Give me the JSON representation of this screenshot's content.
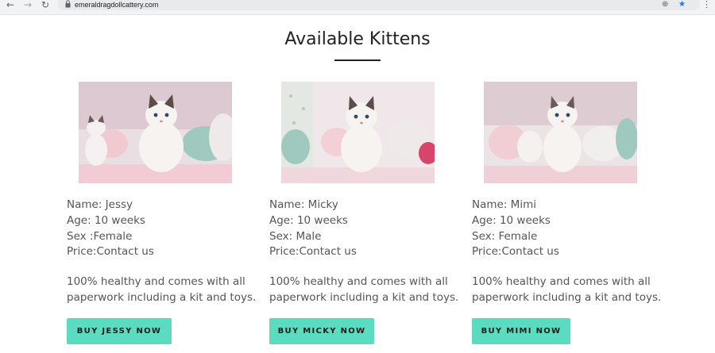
{
  "browser": {
    "url": "emeraldragdollcattery.com",
    "icons": [
      "back-arrow-icon",
      "forward-arrow-icon",
      "reload-icon",
      "lock-icon",
      "zoom-icon",
      "star-icon",
      "menu-icon"
    ]
  },
  "page": {
    "title": "Available Kittens"
  },
  "kittens": [
    {
      "name": "Name: Jessy",
      "age": "Age: 10 weeks",
      "sex": "Sex :Female",
      "price": "Price:Contact us",
      "desc_line1": "100% healthy and comes with all",
      "desc_line2": "paperwork including a kit and toys.",
      "button": "BUY JESSY NOW"
    },
    {
      "name": "Name: Micky",
      "age": "Age: 10 weeks",
      "sex": "Sex: Male",
      "price": "Price:Contact us",
      "desc_line1": "100% healthy and comes with all",
      "desc_line2": "paperwork including a kit and toys.",
      "button": "BUY MICKY NOW"
    },
    {
      "name": "Name: Mimi",
      "age": "Age: 10 weeks",
      "sex": "Sex: Female",
      "price": "Price:Contact us",
      "desc_line1": "100% healthy and comes with all",
      "desc_line2": "paperwork including a kit and toys.",
      "button": "BUY MIMI NOW"
    }
  ],
  "colors": {
    "button": "#5bdcc0",
    "text": "#555555",
    "heading": "#222222",
    "star": "#1a73e8"
  }
}
